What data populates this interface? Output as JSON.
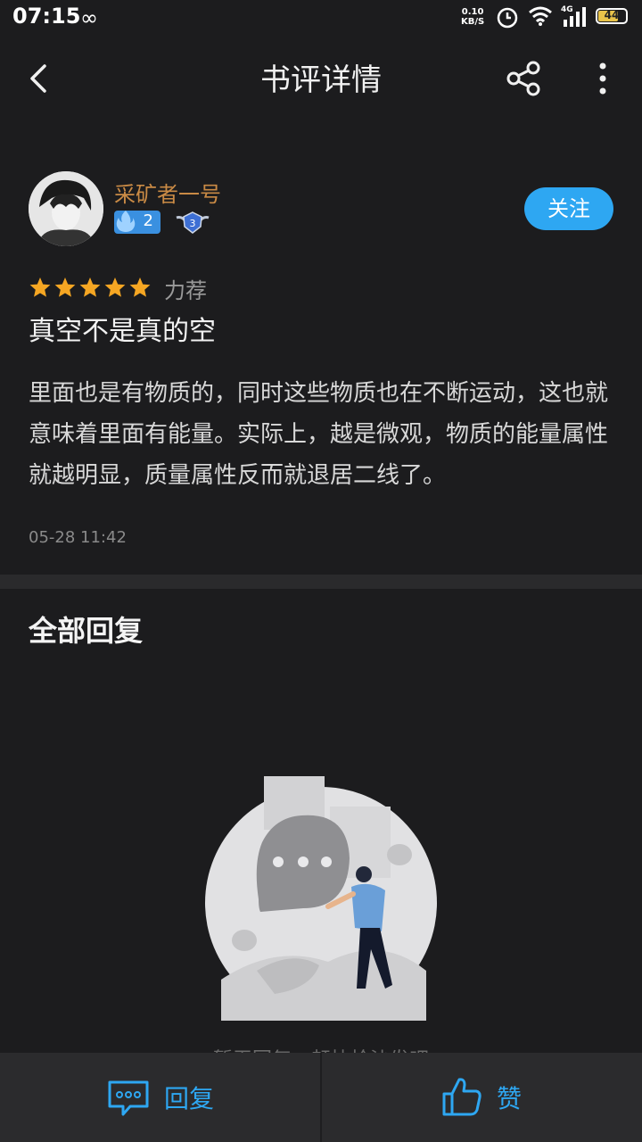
{
  "status_bar": {
    "time": "07:15",
    "infinity": "∞",
    "net_speed_value": "0.10",
    "net_speed_unit": "KB/S",
    "network_type": "4G",
    "battery_level": "44"
  },
  "header": {
    "title": "书评详情",
    "back_icon": "chevron-left-icon",
    "share_icon": "share-icon",
    "more_icon": "more-vertical-icon"
  },
  "user": {
    "name": "采矿者一号",
    "fire_level": "2",
    "rank_badge": "3",
    "follow_label": "关注"
  },
  "review": {
    "stars": 5,
    "rating_label": "力荐",
    "title": "真空不是真的空",
    "body": "里面也是有物质的，同时这些物质也在不断运动，这也就意味着里面有能量。实际上，越是微观，物质的能量属性就越明显，质量属性反而就退居二线了。",
    "date": "05-28 11:42"
  },
  "replies": {
    "heading": "全部回复",
    "empty_text": "暂无回复，赶快抢沙发吧"
  },
  "bottom_bar": {
    "reply_label": "回复",
    "like_label": "赞"
  },
  "colors": {
    "accent": "#2ea7f2",
    "username": "#c98a45",
    "star": "#f5a623",
    "background": "#1c1c1e"
  }
}
